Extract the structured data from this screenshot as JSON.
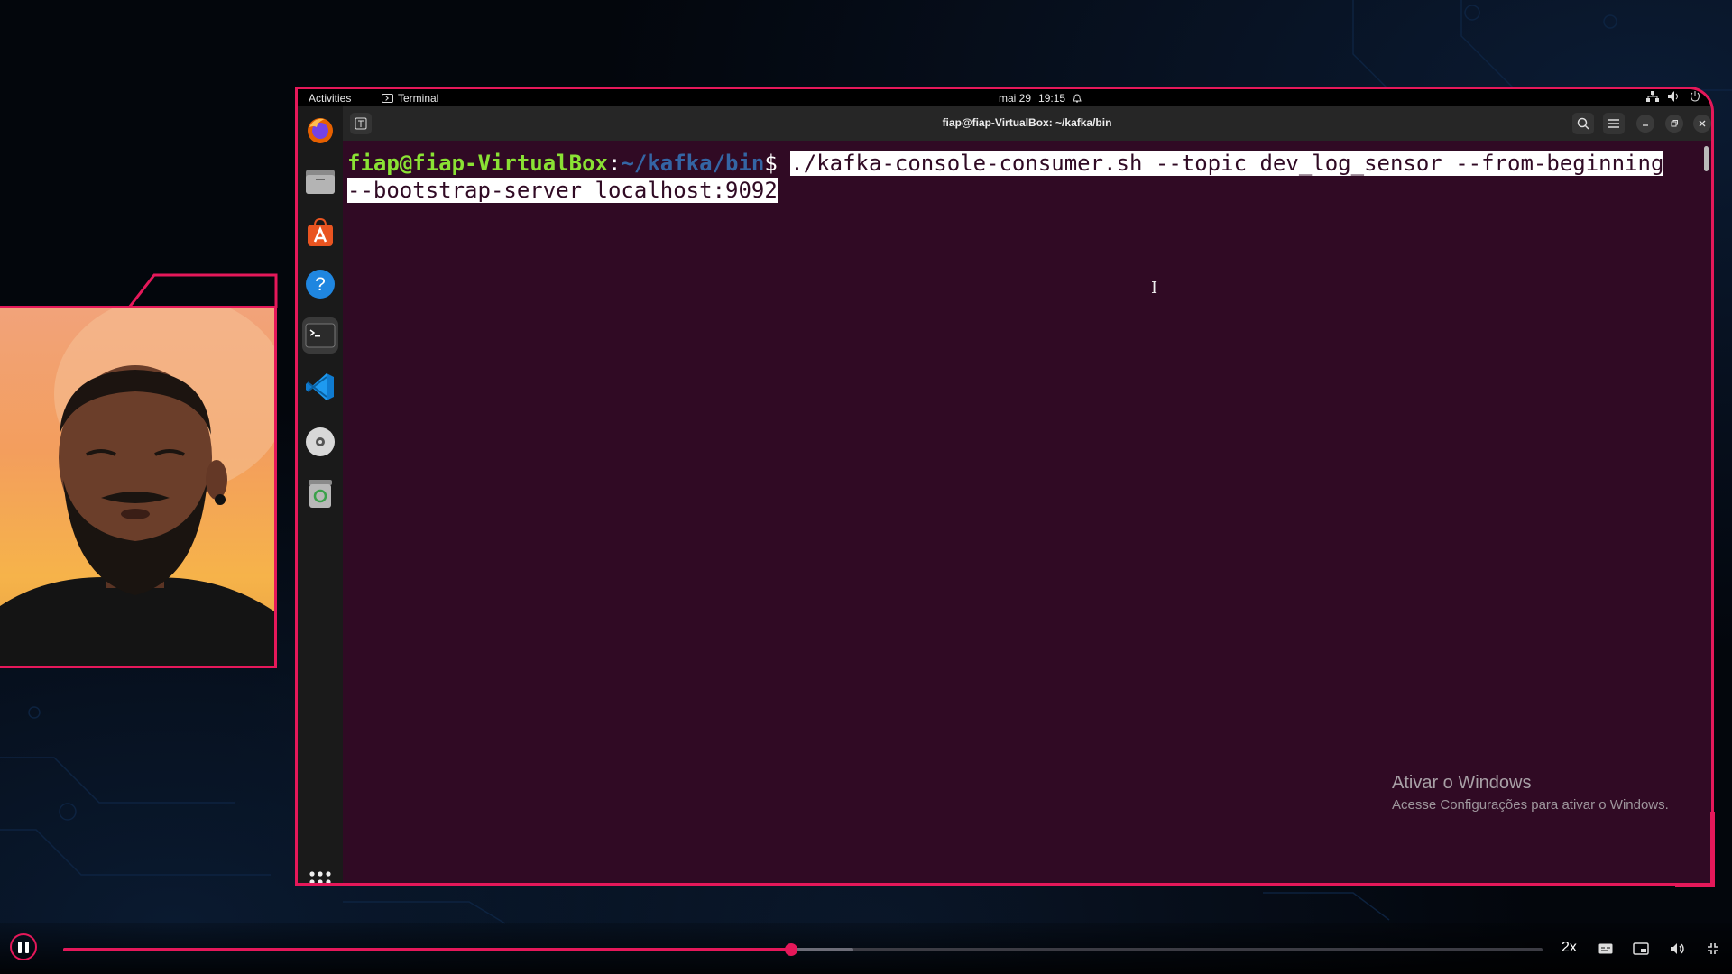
{
  "topbar": {
    "activities": "Activities",
    "app_name": "Terminal",
    "date": "mai 29",
    "time": "19:15"
  },
  "dock": {
    "items": [
      {
        "name": "Firefox",
        "icon": "firefox-icon"
      },
      {
        "name": "Files",
        "icon": "files-icon"
      },
      {
        "name": "Ubuntu Software",
        "icon": "software-store-icon"
      },
      {
        "name": "Help",
        "icon": "help-icon"
      },
      {
        "name": "Terminal",
        "icon": "terminal-icon",
        "active": true
      },
      {
        "name": "Visual Studio Code",
        "icon": "vscode-icon"
      },
      {
        "name": "Disc",
        "icon": "disc-icon"
      },
      {
        "name": "Trash",
        "icon": "trash-icon"
      }
    ],
    "apps_grid_icon": "apps-grid-icon"
  },
  "terminal": {
    "title": "fiap@fiap-VirtualBox: ~/kafka/bin",
    "prompt_user": "fiap@fiap-VirtualBox",
    "prompt_colon": ":",
    "prompt_path": "~/kafka/bin",
    "prompt_sign": "$",
    "command_line1": "./kafka-console-consumer.sh --topic dev_log_sensor --from-beginning",
    "command_line2": "--bootstrap-server localhost:9092"
  },
  "watermark": {
    "title": "Ativar o Windows",
    "subtitle": "Acesse Configurações para ativar o Windows."
  },
  "player": {
    "progress_fraction": 0.492,
    "buffered_fraction": 0.534,
    "speed": "2x"
  },
  "colors": {
    "accent": "#e5185a",
    "terminal_bg": "#300a24",
    "prompt_user": "#8ae234",
    "prompt_path": "#3465a4"
  }
}
